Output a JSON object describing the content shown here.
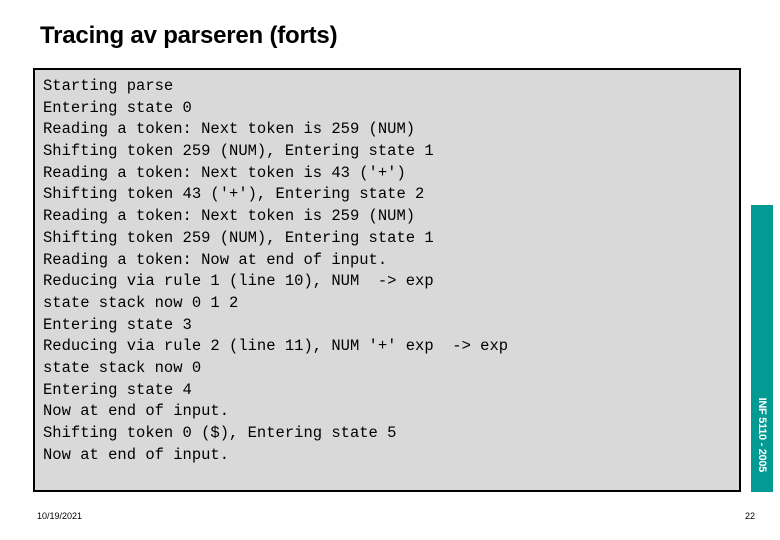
{
  "slide": {
    "title": "Tracing av parseren (forts)",
    "colors": {
      "accent_teal": "#039a94",
      "code_background": "#d9d9d9",
      "code_border": "#000000",
      "text": "#000000",
      "slide_background": "#ffffff"
    }
  },
  "trace_output": {
    "lines": [
      "Starting parse",
      "Entering state 0",
      "Reading a token: Next token is 259 (NUM)",
      "Shifting token 259 (NUM), Entering state 1",
      "Reading a token: Next token is 43 ('+')",
      "Shifting token 43 ('+'), Entering state 2",
      "Reading a token: Next token is 259 (NUM)",
      "Shifting token 259 (NUM), Entering state 1",
      "Reading a token: Now at end of input.",
      "Reducing via rule 1 (line 10), NUM  -> exp",
      "state stack now 0 1 2",
      "Entering state 3",
      "Reducing via rule 2 (line 11), NUM '+' exp  -> exp",
      "state stack now 0",
      "Entering state 4",
      "Now at end of input.",
      "Shifting token 0 ($), Entering state 5",
      "Now at end of input."
    ]
  },
  "side_tab": {
    "label": "INF 5110 - 2005"
  },
  "footer": {
    "date": "10/19/2021",
    "page_number": "22"
  }
}
